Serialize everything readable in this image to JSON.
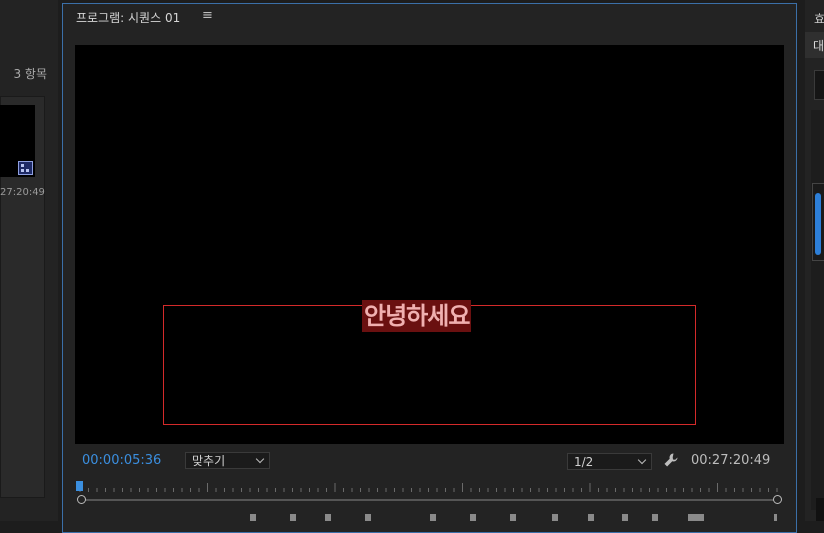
{
  "left_panel": {
    "item_count": "3 항목",
    "clip_duration": "27:20:49"
  },
  "program_monitor": {
    "title": "프로그램: 시퀀스 01",
    "menu_glyph": "≡",
    "caption_text": "안녕하세요",
    "current_timecode": "00:00:05:36",
    "zoom_value": "맞추기",
    "resolution_value": "1/2",
    "total_duration": "00:27:20:49",
    "playhead_position": 0.0
  },
  "right_panel": {
    "title": "효",
    "tab_label": "대"
  },
  "colors": {
    "accent": "#3b8fe0",
    "title_safe_border": "#d42a2a",
    "caption_background": "#6a1010",
    "caption_text": "#f0b0b0",
    "panel_background": "#232323"
  }
}
